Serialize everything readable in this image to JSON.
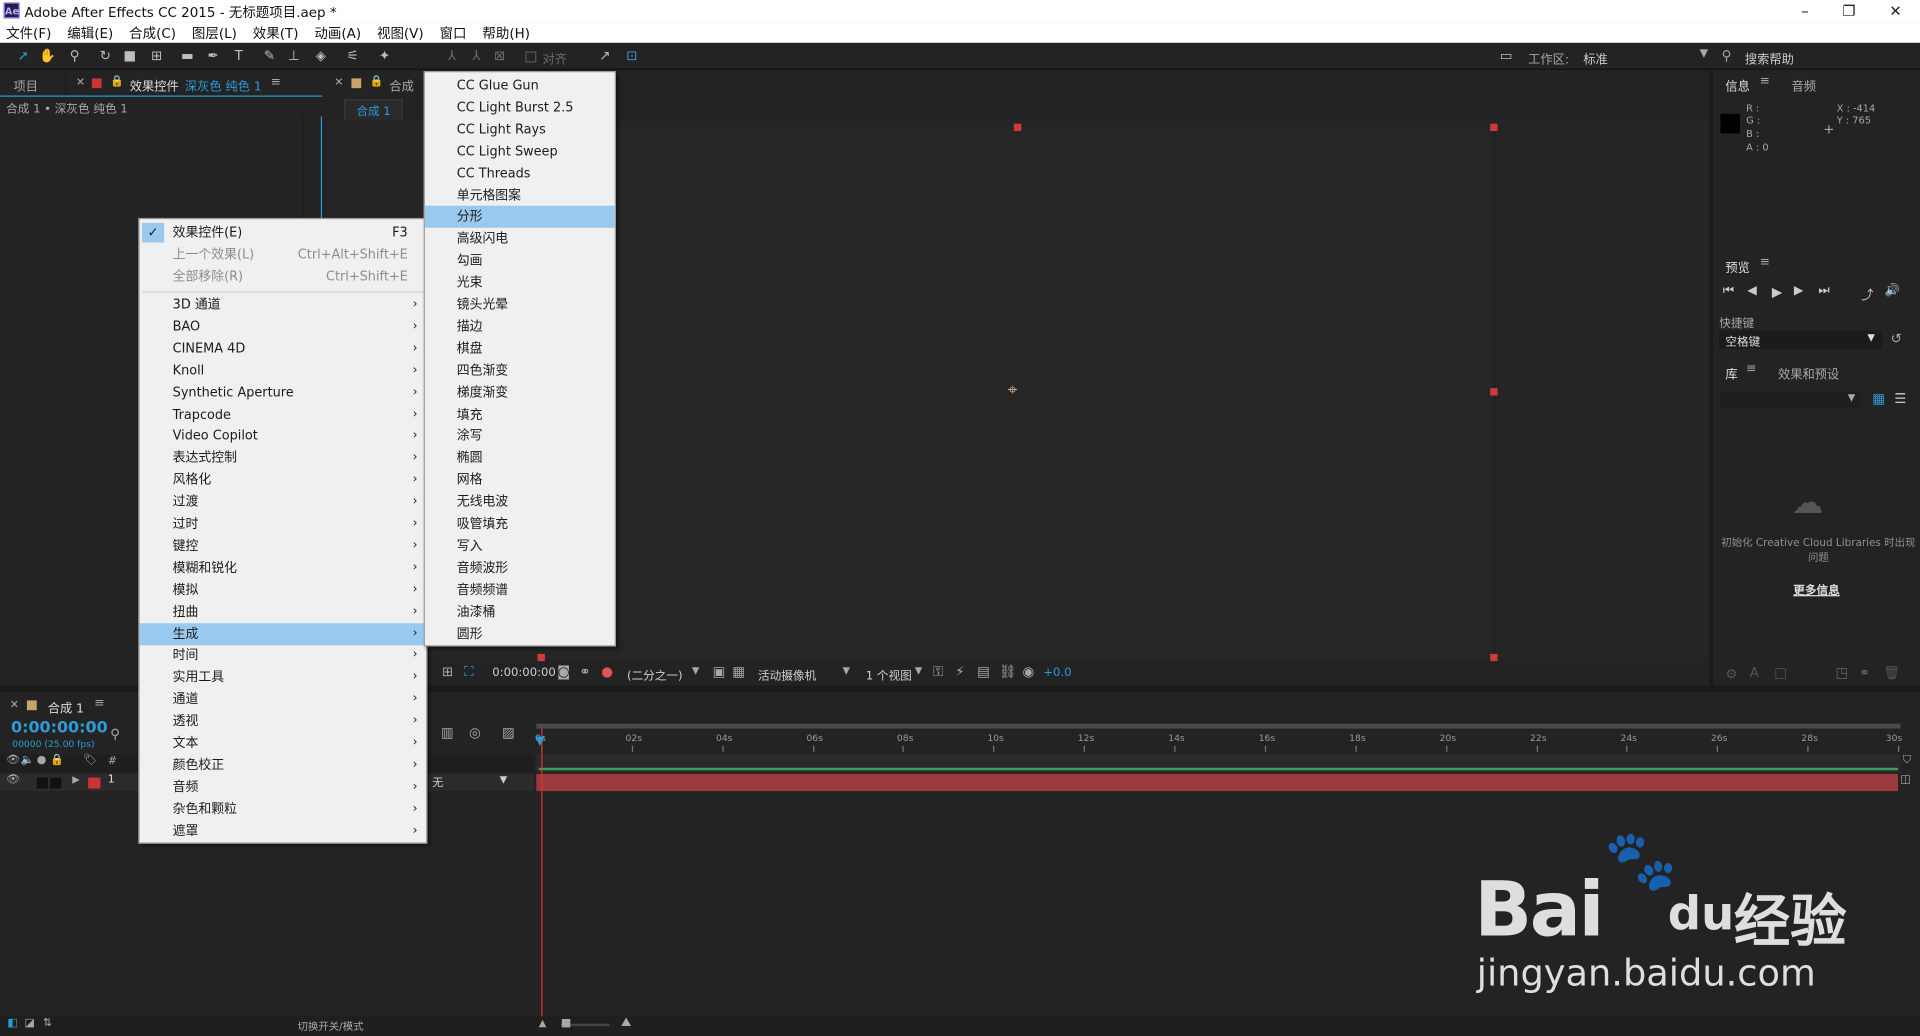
{
  "window": {
    "app_icon": "Ae",
    "title": "Adobe After Effects CC 2015 - 无标题项目.aep *",
    "min": "–",
    "max": "❐",
    "close": "✕"
  },
  "menubar": [
    "文件(F)",
    "编辑(E)",
    "合成(C)",
    "图层(L)",
    "效果(T)",
    "动画(A)",
    "视图(V)",
    "窗口",
    "帮助(H)"
  ],
  "toolbar": {
    "align_label": "对齐",
    "workspace_label": "工作区:",
    "workspace_value": "标准",
    "search_placeholder": "搜索帮助"
  },
  "left_panel": {
    "tab_project": "项目",
    "tab_effects": "效果控件",
    "effects_layer": "深灰色 纯色 1",
    "breadcrumb": "合成 1 • 深灰色 纯色 1"
  },
  "comp_panel": {
    "tab": "合成",
    "sub_tab": "合成 1",
    "bottom": {
      "timecode": "0:00:00:00",
      "resolution": "(二分之一)",
      "camera": "活动摄像机",
      "views": "1 个视图",
      "exposure": "+0.0"
    }
  },
  "info_panel": {
    "tab_info": "信息",
    "tab_audio": "音频",
    "r": "R :",
    "g": "G :",
    "b": "B :",
    "a": "A : 0",
    "x": "X : -414",
    "y": "Y : 765"
  },
  "preview_panel": {
    "tab": "预览",
    "shortcut_label": "快捷键",
    "shortcut_value": "空格键"
  },
  "library_panel": {
    "tab_library": "库",
    "tab_effects_presets": "效果和预设",
    "cc_message": "初始化 Creative Cloud Libraries 时出现问题",
    "more_info": "更多信息"
  },
  "timeline": {
    "tab": "合成 1",
    "timecode": "0:00:00:00",
    "fps": "00000 (25.00 fps)",
    "layer_number": "1",
    "parent_value": "无",
    "hash": "#",
    "toggle_label": "切换开关/模式",
    "ticks": [
      "0s",
      "02s",
      "04s",
      "06s",
      "08s",
      "10s",
      "12s",
      "14s",
      "16s",
      "18s",
      "20s",
      "22s",
      "24s",
      "26s",
      "28s",
      "30s"
    ]
  },
  "context_menu": {
    "top_items": [
      {
        "label": "效果控件(E)",
        "shortcut": "F3",
        "checked": "✓"
      },
      {
        "label": "上一个效果(L)",
        "shortcut": "Ctrl+Alt+Shift+E"
      },
      {
        "label": "全部移除(R)",
        "shortcut": "Ctrl+Shift+E"
      }
    ],
    "submenus": [
      "3D 通道",
      "BAO",
      "CINEMA 4D",
      "Knoll",
      "Synthetic Aperture",
      "Trapcode",
      "Video Copilot",
      "表达式控制",
      "风格化",
      "过渡",
      "过时",
      "键控",
      "模糊和锐化",
      "模拟",
      "扭曲",
      "生成",
      "时间",
      "实用工具",
      "通道",
      "透视",
      "文本",
      "颜色校正",
      "音频",
      "杂色和颗粒",
      "遮罩"
    ],
    "highlighted": "生成"
  },
  "generate_submenu": {
    "items": [
      "CC Glue Gun",
      "CC Light Burst 2.5",
      "CC Light Rays",
      "CC Light Sweep",
      "CC Threads",
      "单元格图案",
      "分形",
      "高级闪电",
      "勾画",
      "光束",
      "镜头光晕",
      "描边",
      "棋盘",
      "四色渐变",
      "梯度渐变",
      "填充",
      "涂写",
      "椭圆",
      "网格",
      "无线电波",
      "吸管填充",
      "写入",
      "音频波形",
      "音频频谱",
      "油漆桶",
      "圆形"
    ],
    "highlighted": "分形"
  },
  "watermark": {
    "brand": "Bai",
    "brand2": "经验",
    "site": "jingyan.baidu.com"
  },
  "colors": {
    "accent": "#2e9ad7",
    "highlight": "#99c9ef",
    "layer": "#9b3a3f",
    "handle": "#d03a3a"
  }
}
